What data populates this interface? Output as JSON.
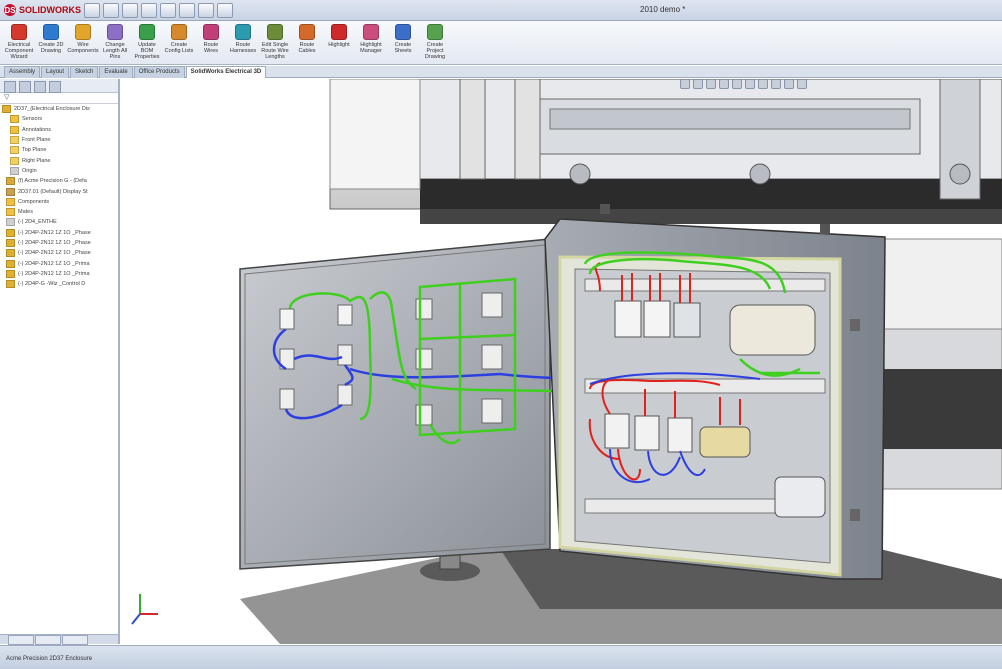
{
  "app": {
    "logo": "SOLIDWORKS",
    "title": "2010 demo *"
  },
  "ribbon": [
    {
      "label": "Electrical Component Wizard",
      "color": "#d33a2c"
    },
    {
      "label": "Create 2D Drawing",
      "color": "#2f7bd1"
    },
    {
      "label": "Wire Components",
      "color": "#e0a52a"
    },
    {
      "label": "Change Length All Pins",
      "color": "#8a6fc4"
    },
    {
      "label": "Update BOM Properties",
      "color": "#3a9f4a"
    },
    {
      "label": "Create Config Lists",
      "color": "#d5892a"
    },
    {
      "label": "Route Wires",
      "color": "#c23f7a"
    },
    {
      "label": "Route Harnesses",
      "color": "#2b9bb0"
    },
    {
      "label": "Edit Single Route Wire Lengths",
      "color": "#6c8c3a"
    },
    {
      "label": "Route Cables",
      "color": "#d46a2a"
    },
    {
      "label": "Highlight",
      "color": "#cf2a2a"
    },
    {
      "label": "Highlight Manager",
      "color": "#cc4d80"
    },
    {
      "label": "Create Sheets",
      "color": "#3b6ec9"
    },
    {
      "label": "Create Project Drawing",
      "color": "#56a14c"
    }
  ],
  "tabs": [
    "Assembly",
    "Layout",
    "Sketch",
    "Evaluate",
    "Office Products",
    "SolidWorks Electrical 3D"
  ],
  "tree": [
    {
      "label": "2D37_(Electrical Enclosure Dis",
      "color": "#e0b030"
    },
    {
      "label": "Sensors",
      "color": "#f0c040"
    },
    {
      "label": "Annotations",
      "color": "#f0c040"
    },
    {
      "label": "Front Plane",
      "color": "#f2d060"
    },
    {
      "label": "Top Plane",
      "color": "#f2d060"
    },
    {
      "label": "Right Plane",
      "color": "#f2d060"
    },
    {
      "label": "Origin",
      "color": "#d0d0d0"
    },
    {
      "label": "(f) Acme Precision G - (Defa",
      "color": "#d9a93a"
    },
    {
      "label": "2D37.01 (Default) Display St",
      "color": "#c8a050"
    },
    {
      "label": "Components",
      "color": "#f0c040"
    },
    {
      "label": "Mates",
      "color": "#f0c040"
    },
    {
      "label": "(-) 2D4_ENTHE",
      "color": "#d0d0d0"
    },
    {
      "label": "(-) 2D4P-2N12 1Z 1O _Phase",
      "color": "#e0b030"
    },
    {
      "label": "(-) 2D4P-2N12 1Z 1O _Phase",
      "color": "#e0b030"
    },
    {
      "label": "(-) 2D4P-2N12 1Z 1O _Phase",
      "color": "#e0b030"
    },
    {
      "label": "(-) 2D4P-2N12 1Z 1O _Prima",
      "color": "#e0b030"
    },
    {
      "label": "(-) 2D4P-2N12 1Z 1O _Prima",
      "color": "#e0b030"
    },
    {
      "label": "(-) 2D4P-G -Wiz _Control D",
      "color": "#e0b030"
    }
  ],
  "filter": "▽",
  "status": "Acme Precision 2D37 Enclosure"
}
